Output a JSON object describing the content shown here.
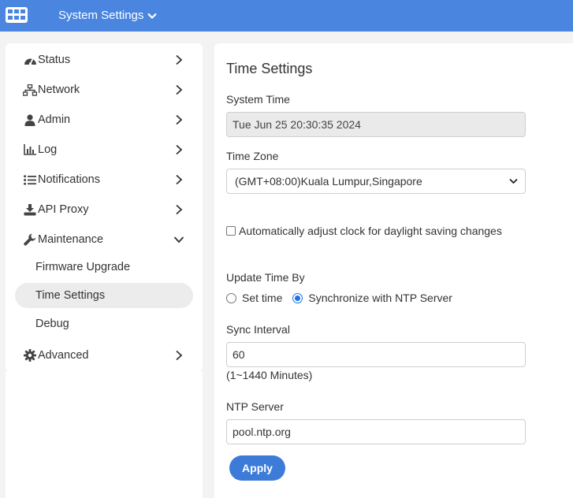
{
  "header": {
    "title": "System Settings",
    "logo_icon": "grid-logo-icon",
    "brand_color": "#4a86e0"
  },
  "sidebar": {
    "items": [
      {
        "label": "Status",
        "icon": "dashboard-icon"
      },
      {
        "label": "Network",
        "icon": "network-icon"
      },
      {
        "label": "Admin",
        "icon": "user-icon"
      },
      {
        "label": "Log",
        "icon": "chart-icon"
      },
      {
        "label": "Notifications",
        "icon": "list-icon"
      },
      {
        "label": "API Proxy",
        "icon": "download-icon"
      },
      {
        "label": "Maintenance",
        "icon": "wrench-icon",
        "expanded": true
      },
      {
        "label": "Advanced",
        "icon": "gear-icon"
      }
    ],
    "sub_items": [
      {
        "label": "Firmware Upgrade"
      },
      {
        "label": "Time Settings",
        "active": true
      },
      {
        "label": "Debug"
      }
    ]
  },
  "main": {
    "title": "Time Settings",
    "system_time_label": "System Time",
    "system_time_value": "Tue Jun 25 20:30:35 2024",
    "time_zone_label": "Time Zone",
    "time_zone_value": "(GMT+08:00)Kuala Lumpur,Singapore",
    "dst_label": "Automatically adjust clock for daylight saving changes",
    "dst_checked": false,
    "update_label": "Update Time By",
    "update_options": [
      "Set time",
      "Synchronize with NTP Server"
    ],
    "update_selected": "Synchronize with NTP Server",
    "sync_interval_label": "Sync Interval",
    "sync_interval_value": "60",
    "sync_interval_hint": "(1~1440 Minutes)",
    "ntp_label": "NTP Server",
    "ntp_value": "pool.ntp.org",
    "apply_label": "Apply",
    "accent_color": "#3d7bd9"
  }
}
